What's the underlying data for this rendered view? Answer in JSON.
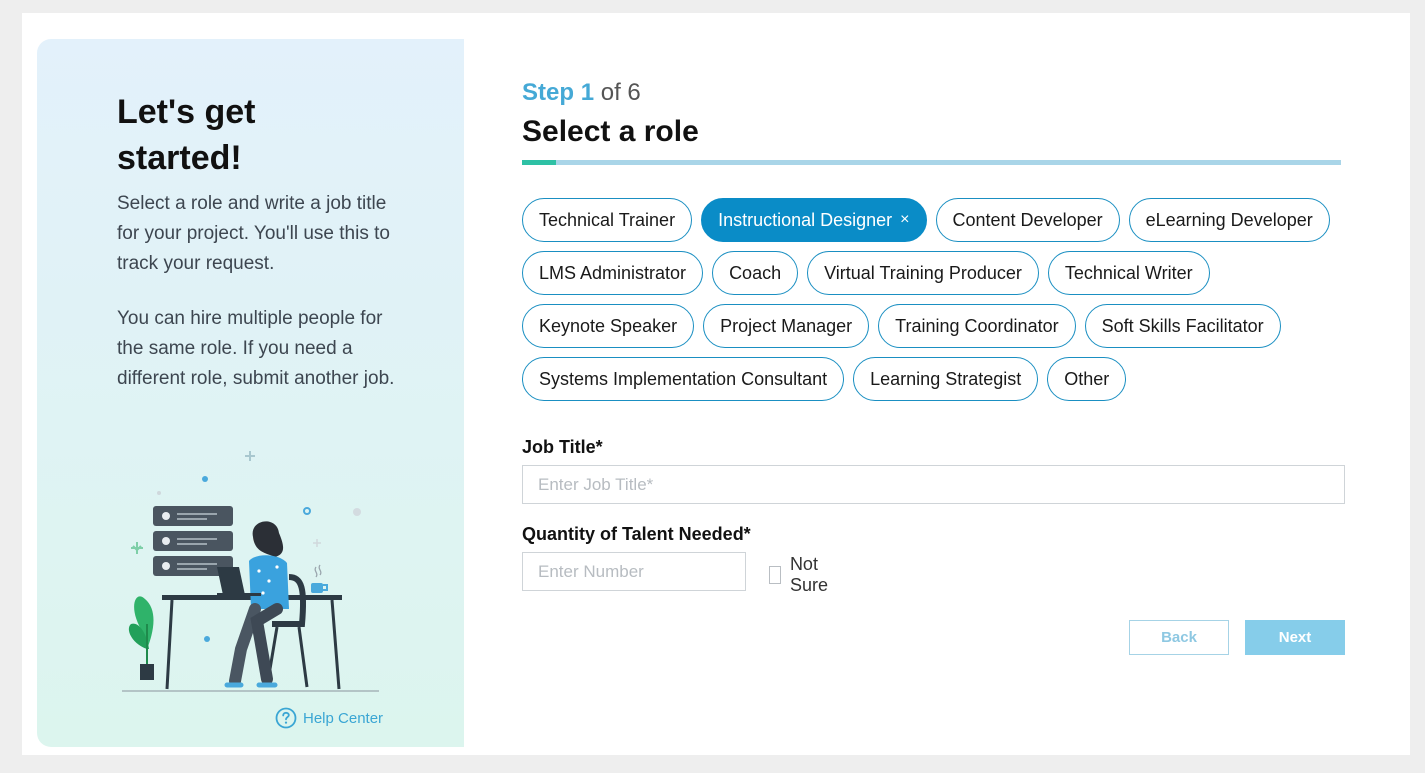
{
  "sidebar": {
    "title": "Let's get started!",
    "paragraph1": "Select a role and write a job title for your project. You'll use this to track your request.",
    "paragraph2": "You can hire multiple people for the same role. If you need a different role, submit another job.",
    "help_center_label": "Help Center",
    "help_icon": "question-circle-icon",
    "illustration": "person-at-desk-illustration"
  },
  "step": {
    "prefix": "Step",
    "current": "1",
    "of_label": "of 6",
    "progress": 0.042
  },
  "page_title": "Select a role",
  "roles": [
    {
      "label": "Technical Trainer",
      "selected": false
    },
    {
      "label": "Instructional Designer",
      "selected": true
    },
    {
      "label": "Content Developer",
      "selected": false
    },
    {
      "label": "eLearning Developer",
      "selected": false
    },
    {
      "label": "LMS Administrator",
      "selected": false
    },
    {
      "label": "Coach",
      "selected": false
    },
    {
      "label": "Virtual Training Producer",
      "selected": false
    },
    {
      "label": "Technical Writer",
      "selected": false
    },
    {
      "label": "Keynote Speaker",
      "selected": false
    },
    {
      "label": "Project Manager",
      "selected": false
    },
    {
      "label": "Training Coordinator",
      "selected": false
    },
    {
      "label": "Soft Skills Facilitator",
      "selected": false
    },
    {
      "label": "Systems Implementation Consultant",
      "selected": false
    },
    {
      "label": "Learning Strategist",
      "selected": false
    },
    {
      "label": "Other",
      "selected": false
    }
  ],
  "remove_symbol": "×",
  "job_title": {
    "label": "Job Title*",
    "value": "",
    "placeholder": "Enter Job Title*"
  },
  "quantity": {
    "label": "Quantity of Talent Needed*",
    "value": "",
    "placeholder": "Enter Number",
    "not_sure_label": "Not Sure",
    "not_sure_checked": false
  },
  "buttons": {
    "back_label": "Back",
    "next_label": "Next"
  },
  "colors": {
    "accent": "#0a8cc7",
    "step_highlight": "#45a9d6",
    "progress_fill": "#2ec1a5",
    "progress_track": "#a9d5e8",
    "next_disabled": "#86cdea"
  }
}
